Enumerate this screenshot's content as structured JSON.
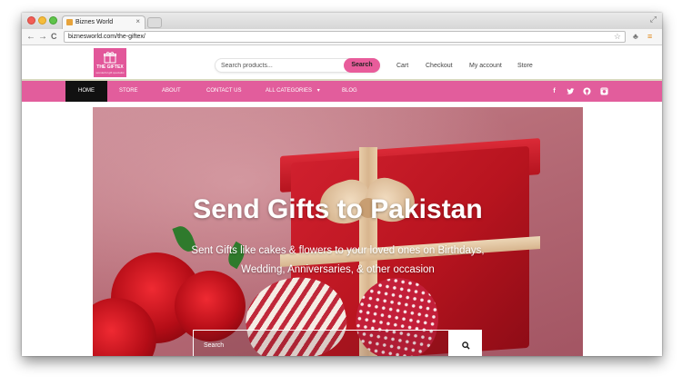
{
  "browser": {
    "tab_title": "Biznes World",
    "tab_close": "×",
    "url": "biznesworld.com/the-giftex/",
    "nav_back": "←",
    "nav_forward": "→",
    "nav_reload": "C"
  },
  "header": {
    "logo_name": "THE GIFTEX",
    "logo_tagline": "wonderful gift specialist",
    "search_placeholder": "Search products...",
    "search_button": "Search",
    "links": [
      "Cart",
      "Checkout",
      "My account",
      "Store"
    ]
  },
  "nav": {
    "items": [
      "HOME",
      "STORE",
      "ABOUT",
      "CONTACT US",
      "ALL CATEGORIES",
      "BLOG"
    ],
    "dropdown_caret": "▾",
    "social": [
      "f",
      "t",
      "g",
      "i"
    ]
  },
  "hero": {
    "title": "Send Gifts to Pakistan",
    "subtitle": "Sent  Gifts like cakes & flowers to your loved ones on Birthdays, Wedding, Anniversaries, & other occasion",
    "search_placeholder": "Search"
  },
  "colors": {
    "brand_pink": "#e25d9c",
    "nav_active": "#111111"
  },
  "icons": [
    "gift-icon",
    "search-icon",
    "facebook-icon",
    "twitter-icon",
    "github-icon",
    "instagram-icon",
    "star-icon",
    "menu-icon"
  ]
}
